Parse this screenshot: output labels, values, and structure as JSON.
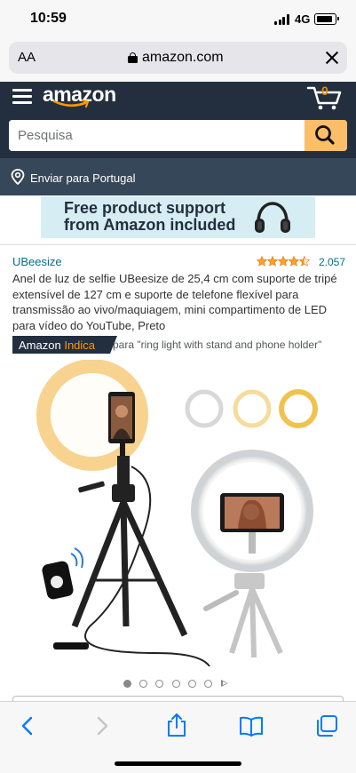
{
  "status_bar": {
    "time": "10:59",
    "network": "4G"
  },
  "browser": {
    "text_size_label": "AA",
    "url": "amazon.com",
    "close_icon": "close-icon"
  },
  "header": {
    "logo_text": "amazon",
    "cart_count": "0",
    "search_placeholder": "Pesquisa"
  },
  "deliver": {
    "label": "Enviar para Portugal"
  },
  "banner": {
    "line1": "Free product support",
    "line2": "from Amazon included"
  },
  "product": {
    "brand": "UBeesize",
    "rating": 4.5,
    "reviews": "2.057",
    "title": "Anel de luz de selfie UBeesize de 25,4 cm com suporte de tripé extensível de 127 cm e suporte de telefone flexível para transmissão ao vivo/maquiagem, mini compartimento de LED para vídeo do YouTube, Preto",
    "choice_part1": "Amazon",
    "choice_part2": "Indica",
    "choice_for": "para \"ring light with stand and phone holder\"",
    "image_count": 6,
    "active_image": 1
  },
  "colors": {
    "header_bg": "#232f3e",
    "deliver_bg": "#37475a",
    "search_button": "#febd69",
    "link": "#007185",
    "star": "#ffa41c",
    "ios_blue": "#007aff"
  },
  "toolbar": {
    "back": "chevron-left-icon",
    "forward": "chevron-right-icon",
    "share": "share-icon",
    "bookmarks": "book-icon",
    "tabs": "tabs-icon"
  }
}
